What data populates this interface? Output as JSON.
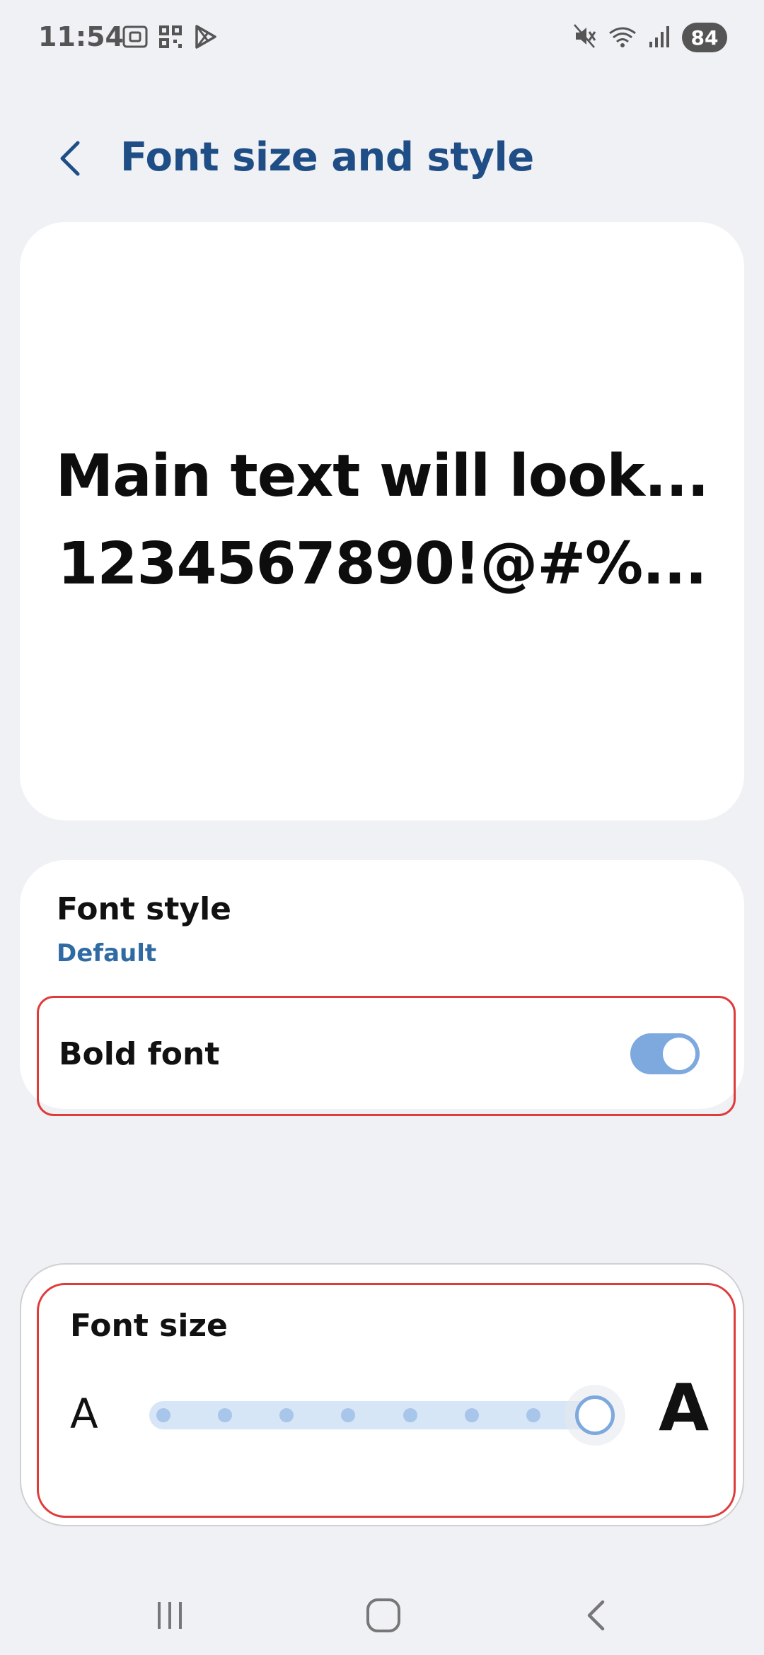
{
  "status_bar": {
    "time": "11:54",
    "battery": "84",
    "left_icons": [
      "screenshot-icon",
      "qr-icon",
      "play-store-icon"
    ],
    "right_icons": [
      "mute-icon",
      "wifi-icon",
      "signal-icon"
    ]
  },
  "header": {
    "title": "Font size and style"
  },
  "preview": {
    "line1": "Main text will look...",
    "line2": "1234567890!@#%..."
  },
  "font_style": {
    "title": "Font style",
    "value": "Default"
  },
  "bold_font": {
    "label": "Bold font",
    "enabled": true
  },
  "font_size": {
    "title": "Font size",
    "small_label": "A",
    "large_label": "A",
    "steps": 8,
    "selected_step": 8
  },
  "colors": {
    "title": "#1f4e86",
    "accent": "#2f6aa3",
    "toggle_on": "#7ea9de",
    "highlight_box": "#e03b3b",
    "background": "#f0f1f5"
  }
}
